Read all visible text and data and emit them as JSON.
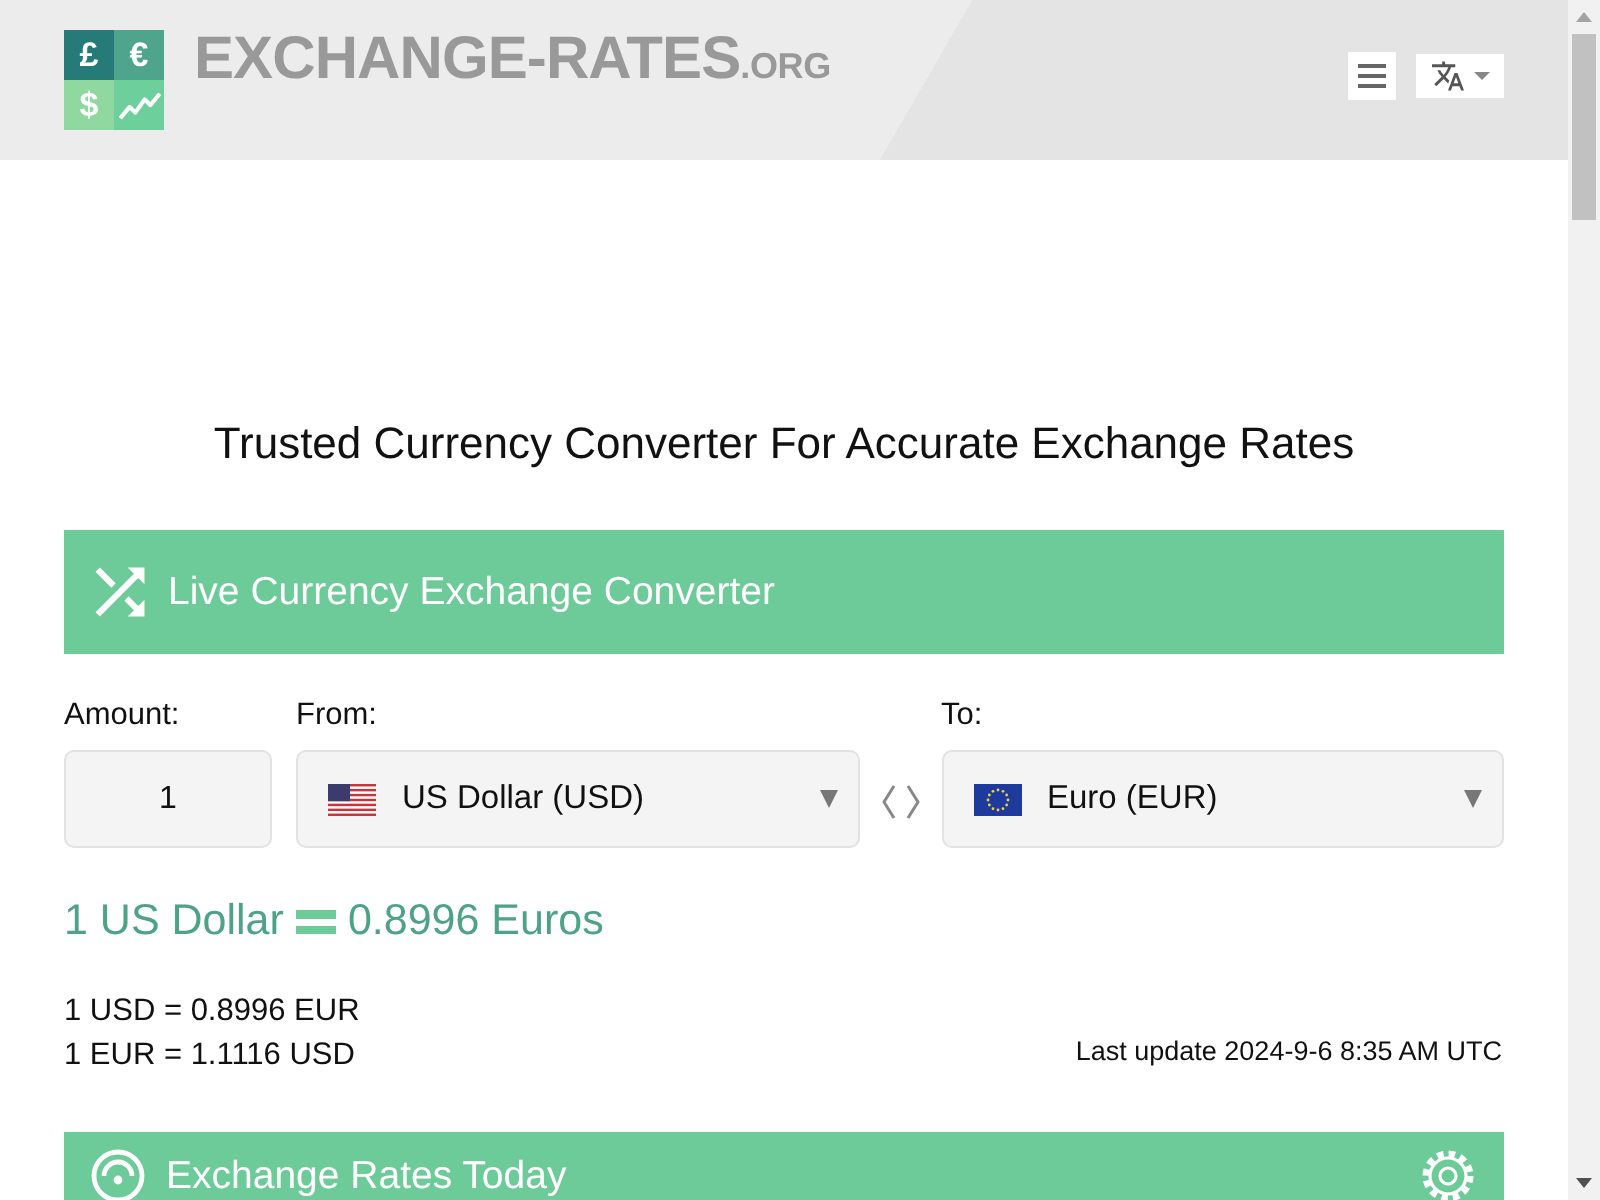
{
  "header": {
    "logo": {
      "tiles": [
        {
          "kind": "symbol",
          "symbol": "£",
          "color": "#267b79"
        },
        {
          "kind": "symbol",
          "symbol": "€",
          "color": "#4fa58c"
        },
        {
          "kind": "symbol",
          "symbol": "$",
          "color": "#8fd8a0"
        },
        {
          "kind": "chart",
          "color": "#6dcf9b"
        }
      ]
    },
    "site_name": "EXCHANGE-RATES",
    "site_suffix": ".ORG"
  },
  "heading": "Trusted Currency Converter For Accurate Exchange Rates",
  "converter": {
    "title": "Live Currency Exchange Converter",
    "amount": {
      "label": "Amount:",
      "value": "1"
    },
    "from": {
      "label": "From:",
      "flag": {
        "kind": "us"
      },
      "currency": "US Dollar (USD)"
    },
    "to": {
      "label": "To:",
      "flag": {
        "kind": "eu"
      },
      "currency": "Euro (EUR)"
    },
    "result": {
      "from_text": "1 US Dollar",
      "to_text": "0.8996 Euros"
    },
    "rates": [
      "1 USD = 0.8996 EUR",
      "1 EUR = 1.1116 USD"
    ],
    "last_update": "Last update 2024-9-6 8:35 AM UTC"
  },
  "rates_today": {
    "title": "Exchange Rates Today"
  }
}
